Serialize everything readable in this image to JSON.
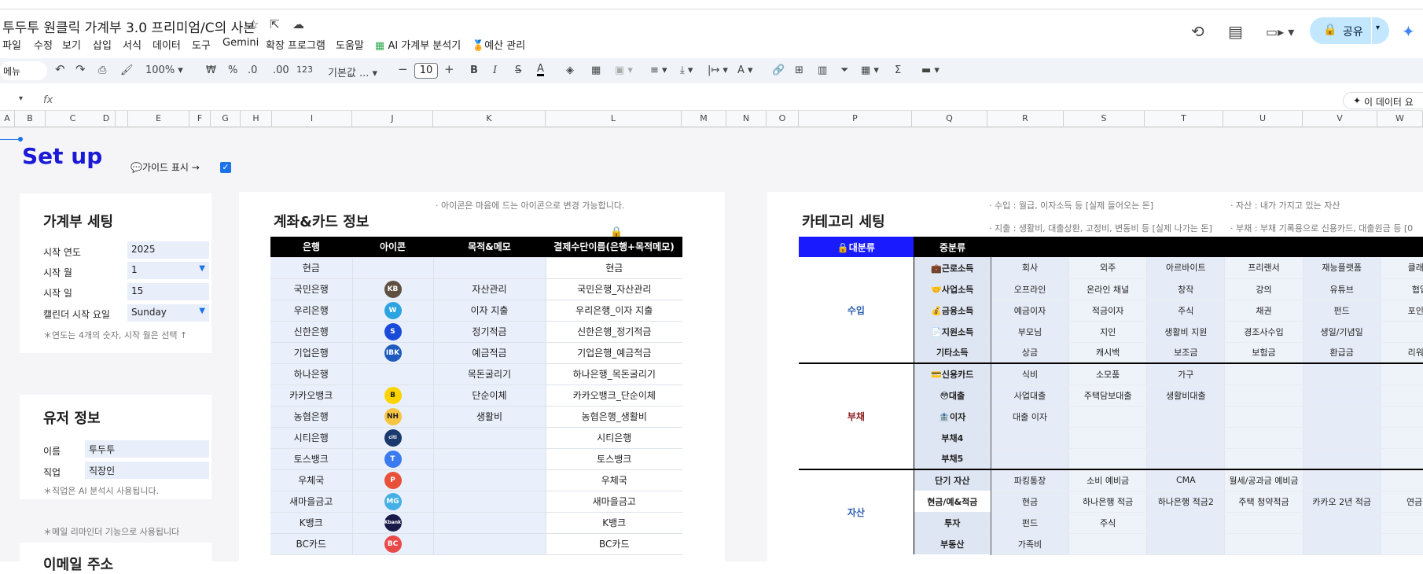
{
  "title": "투두투 원클릭 가계부 3.0 프리미엄/C의 사본",
  "menu": [
    "파일",
    "수정",
    "보기",
    "삽입",
    "서식",
    "데이터",
    "도구",
    "Gemini",
    "확장 프로그램",
    "도움말",
    "AI 가계부 분석기",
    "예산 관리"
  ],
  "share_label": "공유",
  "toolbar": {
    "search": "메뉴",
    "zoom": "100%",
    "currency": "₩",
    "percent": "%",
    "dec_less": ".0",
    "dec_more": ".00",
    "num": "123",
    "font": "기본값 ...",
    "size": "10"
  },
  "ai_chip": "이 데이터 요",
  "columns": [
    "A",
    "B",
    "C",
    "D",
    "E",
    "F",
    "G",
    "H",
    "I",
    "J",
    "K",
    "L",
    "M",
    "N",
    "O",
    "P",
    "Q",
    "R",
    "S",
    "T",
    "U",
    "V",
    "W"
  ],
  "setup_title": "Set up",
  "guide_label": "가이드 표시 →",
  "ledger": {
    "title": "가계부 세팅",
    "rows": [
      {
        "label": "시작 연도",
        "value": "2025"
      },
      {
        "label": "시작 월",
        "value": "1"
      },
      {
        "label": "시작 일",
        "value": "15"
      },
      {
        "label": "캘린더 시작 요일",
        "value": "Sunday"
      }
    ],
    "note": "＊연도는 4개의 숫자, 시작 월은 선택 ↑"
  },
  "user": {
    "title": "유저 정보",
    "rows": [
      {
        "label": "이름",
        "value": "투두투"
      },
      {
        "label": "직업",
        "value": "직장인"
      }
    ],
    "note": "＊직업은 AI 분석시 사용됩니다.",
    "mail_note": "＊메일 리마인더 기능으로 사용됩니다",
    "email_title": "이메일 주소"
  },
  "accounts": {
    "title": "계좌&카드 정보",
    "hint": "· 아이콘은 마음에 드는 아이콘으로 변경 가능합니다.",
    "headers": [
      "은행",
      "아이콘",
      "목적&메모",
      "결제수단이름(은행+목적메모)"
    ],
    "rows": [
      {
        "bank": "현금",
        "icon": "",
        "memo": "",
        "name": "현금"
      },
      {
        "bank": "국민은행",
        "icon": "KB",
        "memo": "자산관리",
        "name": "국민은행_자산관리"
      },
      {
        "bank": "우리은행",
        "icon": "W",
        "memo": "이자 지출",
        "name": "우리은행_이자 지출"
      },
      {
        "bank": "신한은행",
        "icon": "S",
        "memo": "정기적금",
        "name": "신한은행_정기적금"
      },
      {
        "bank": "기업은행",
        "icon": "IBK",
        "memo": "예금적금",
        "name": "기업은행_예금적금"
      },
      {
        "bank": "하나은행",
        "icon": "",
        "memo": "목돈굴리기",
        "name": "하나은행_목돈굴리기"
      },
      {
        "bank": "카카오뱅크",
        "icon": "B",
        "memo": "단순이체",
        "name": "카카오뱅크_단순이체"
      },
      {
        "bank": "농협은행",
        "icon": "NH",
        "memo": "생활비",
        "name": "농협은행_생활비"
      },
      {
        "bank": "시티은행",
        "icon": "citi",
        "memo": "",
        "name": "시티은행"
      },
      {
        "bank": "토스뱅크",
        "icon": "T",
        "memo": "",
        "name": "토스뱅크"
      },
      {
        "bank": "우체국",
        "icon": "P",
        "memo": "",
        "name": "우체국"
      },
      {
        "bank": "새마을금고",
        "icon": "MG",
        "memo": "",
        "name": "새마을금고"
      },
      {
        "bank": "K뱅크",
        "icon": "Kbank",
        "memo": "",
        "name": "K뱅크"
      },
      {
        "bank": "BC카드",
        "icon": "BC",
        "memo": "",
        "name": "BC카드"
      }
    ]
  },
  "category": {
    "title": "카테고리 세팅",
    "hints": [
      "· 수입 : 월급, 이자소득 등 [실제 들어오는 돈]",
      "· 자산 : 내가 가지고 있는 자산",
      "· 지출 : 생활비, 대출상환, 고정비, 변동비 등 [실제 나가는 돈]",
      "· 부채 : 부채 기록용으로 신용카드, 대출원금 등 [0"
    ],
    "headers": [
      "대분류",
      "중분류"
    ],
    "groups": [
      {
        "major": "수입",
        "color": "#2b5fb0",
        "rows": [
          {
            "sub": "💼근로소득",
            "items": [
              "회사",
              "외주",
              "아르바이트",
              "프리랜서",
              "재능플랫폼",
              "클래스"
            ]
          },
          {
            "sub": "🤝사업소득",
            "items": [
              "오프라인",
              "온라인 채널",
              "창작",
              "강의",
              "유튜브",
              "협업"
            ]
          },
          {
            "sub": "💰금융소득",
            "items": [
              "예금이자",
              "적금이자",
              "주식",
              "채권",
              "펀드",
              "포인트"
            ]
          },
          {
            "sub": "📄지원소득",
            "items": [
              "부모님",
              "지인",
              "생활비 지원",
              "경조사수입",
              "생일/기념일",
              ""
            ]
          },
          {
            "sub": "기타소득",
            "items": [
              "상금",
              "캐시백",
              "보조금",
              "보험금",
              "환급금",
              "리워드"
            ]
          }
        ]
      },
      {
        "major": "부채",
        "color": "#8b1a1a",
        "rows": [
          {
            "sub": "💳신용카드",
            "items": [
              "식비",
              "소모품",
              "가구",
              "",
              "",
              ""
            ]
          },
          {
            "sub": "😳대출",
            "items": [
              "사업대출",
              "주택담보대출",
              "생활비대출",
              "",
              "",
              ""
            ]
          },
          {
            "sub": "🏦이자",
            "items": [
              "대출 이자",
              "",
              "",
              "",
              "",
              ""
            ]
          },
          {
            "sub": "부채4",
            "items": [
              "",
              "",
              "",
              "",
              "",
              ""
            ]
          },
          {
            "sub": "부채5",
            "items": [
              "",
              "",
              "",
              "",
              "",
              ""
            ]
          }
        ]
      },
      {
        "major": "자산",
        "color": "#2b5fb0",
        "rows": [
          {
            "sub": "단기 자산",
            "items": [
              "파킹통장",
              "소비 예비금",
              "CMA",
              "월세/공과금 예비금",
              "",
              ""
            ]
          },
          {
            "sub": "현금/예&적금",
            "items": [
              "현금",
              "하나은행 적금",
              "하나은행 적금2",
              "주택 청약적금",
              "카카오 2년 적금",
              "연금 저"
            ]
          },
          {
            "sub": "투자",
            "items": [
              "펀드",
              "주식",
              "",
              "",
              "",
              ""
            ]
          },
          {
            "sub": "부동산",
            "items": [
              "가족비",
              "",
              "",
              "",
              "",
              ""
            ]
          }
        ]
      }
    ]
  }
}
